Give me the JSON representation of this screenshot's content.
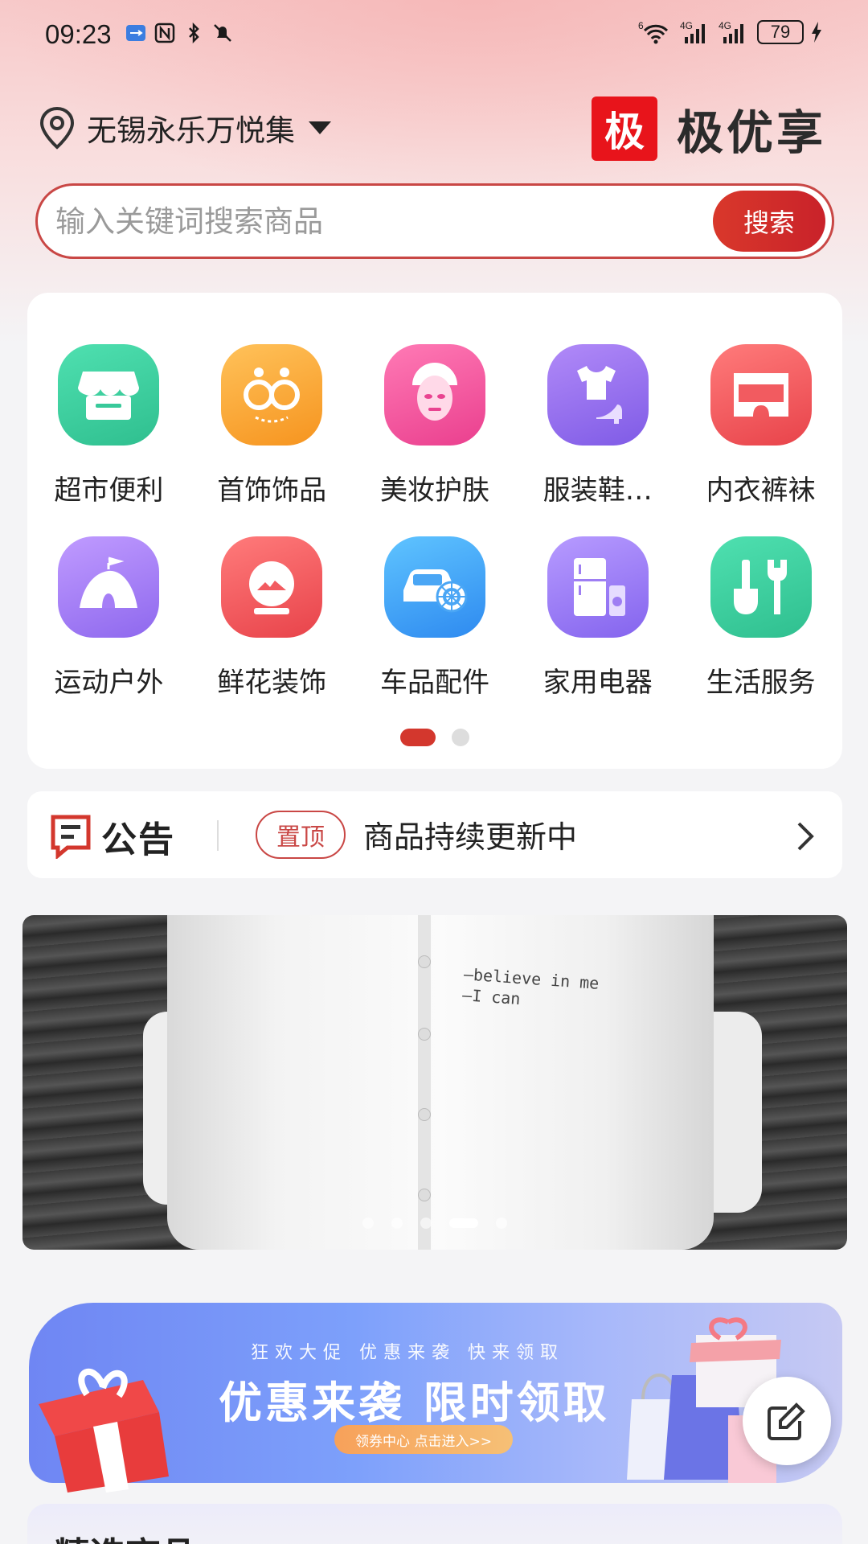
{
  "status_bar": {
    "time": "09:23",
    "network_label_1": "4G",
    "network_label_2": "4G",
    "wifi_badge": "6",
    "battery": "79"
  },
  "header": {
    "location": "无锡永乐万悦集",
    "brand_mark": "极",
    "brand_name": "极优享"
  },
  "search": {
    "placeholder": "输入关键词搜索商品",
    "button_label": "搜索"
  },
  "categories": [
    {
      "label": "超市便利",
      "icon": "store-icon",
      "color": "#3ecfa0"
    },
    {
      "label": "首饰饰品",
      "icon": "earrings-icon",
      "color": "#f8a53b"
    },
    {
      "label": "美妆护肤",
      "icon": "face-mask-icon",
      "color": "#f2589e"
    },
    {
      "label": "服装鞋…",
      "icon": "clothing-shoe-icon",
      "color": "#9a6ff0"
    },
    {
      "label": "内衣裤袜",
      "icon": "underwear-icon",
      "color": "#f0575a"
    },
    {
      "label": "运动户外",
      "icon": "tent-icon",
      "color": "#a77cf4"
    },
    {
      "label": "鲜花装饰",
      "icon": "flower-decor-icon",
      "color": "#f0575a"
    },
    {
      "label": "车品配件",
      "icon": "car-icon",
      "color": "#4aa6f5"
    },
    {
      "label": "家用电器",
      "icon": "fridge-icon",
      "color": "#9e7ef3"
    },
    {
      "label": "生活服务",
      "icon": "tools-icon",
      "color": "#3ecfa0"
    }
  ],
  "category_pager": {
    "pages": 2,
    "active": 1
  },
  "notice": {
    "title": "公告",
    "tag": "置顶",
    "text": "商品持续更新中"
  },
  "banner": {
    "print_line_1": "—believe in me",
    "print_line_2": "—I can",
    "slides": 5,
    "active_slide": 4
  },
  "promo": {
    "subtitle": "狂欢大促 优惠来袭 快来领取",
    "title": "优惠来袭 限时领取",
    "cta": "领券中心 点击进入>>"
  },
  "featured": {
    "title": "精选商品"
  },
  "colors": {
    "accent": "#d3372d",
    "brand_red": "#e8141b"
  }
}
